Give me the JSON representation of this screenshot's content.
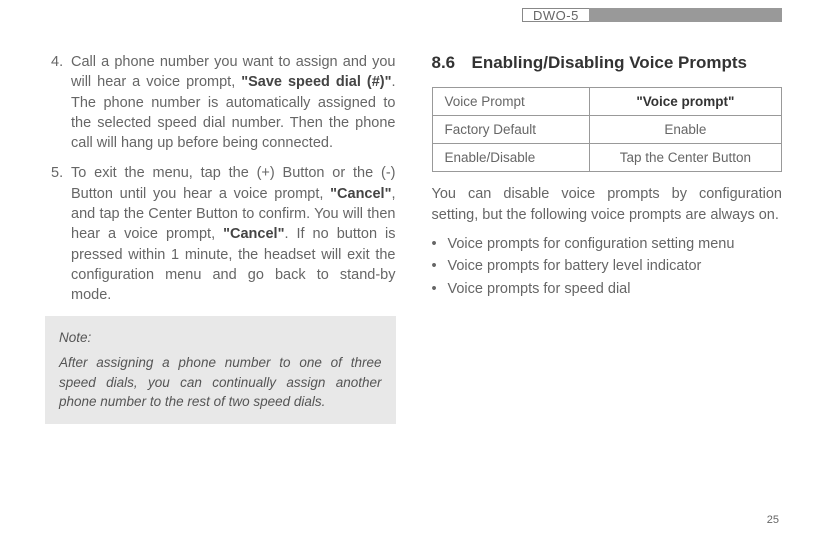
{
  "header": {
    "model": "DWO-5"
  },
  "left": {
    "items": [
      {
        "num": "4.",
        "pre": "Call a phone number you want to assign and you will hear a voice prompt, ",
        "bold1": "\"Save speed dial (#)\"",
        "post": ". The phone number is automatically assigned to the selected speed dial number. Then the phone call will hang up before being connected."
      },
      {
        "num": "5.",
        "seg1": "To exit the menu, tap the (+) Button or the (-) Button until you hear a voice prompt, ",
        "bold1": "\"Cancel\"",
        "seg2": ", and tap the Center Button to confirm. You will then hear a voice prompt, ",
        "bold2": "\"Cancel\"",
        "seg3": ". If no button is pressed within 1 minute, the headset will exit the configuration menu and go back to stand-by mode."
      }
    ],
    "note": {
      "title": "Note:",
      "body": "After assigning a phone number to one of three speed dials, you can continually assign another phone number to the rest of two speed dials."
    }
  },
  "right": {
    "section_num": "8.6",
    "section_title": "Enabling/Disabling Voice Prompts",
    "table": {
      "r1c1": "Voice Prompt",
      "r1c2": "\"Voice prompt\"",
      "r2c1": "Factory Default",
      "r2c2": "Enable",
      "r3c1": "Enable/Disable",
      "r3c2": "Tap the Center Button"
    },
    "para": "You can disable voice prompts by configuration setting, but the following voice prompts are always on.",
    "bullets": [
      "Voice prompts for configuration setting menu",
      "Voice prompts for battery level indicator",
      "Voice prompts for speed dial"
    ]
  },
  "page_num": "25"
}
